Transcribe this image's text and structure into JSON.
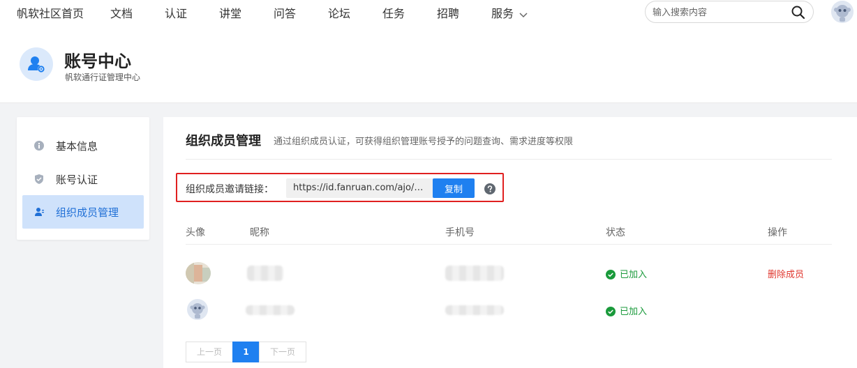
{
  "nav": {
    "items": [
      "帆软社区首页",
      "文档",
      "认证",
      "讲堂",
      "问答",
      "论坛",
      "任务",
      "招聘",
      "服务"
    ],
    "search_placeholder": "输入搜索内容"
  },
  "header": {
    "title": "账号中心",
    "subtitle": "帆软通行证管理中心"
  },
  "sidebar": {
    "items": [
      {
        "label": "基本信息",
        "icon": "info-icon"
      },
      {
        "label": "账号认证",
        "icon": "shield-icon"
      },
      {
        "label": "组织成员管理",
        "icon": "user-icon",
        "active": true
      }
    ]
  },
  "main": {
    "title": "组织成员管理",
    "description": "通过组织成员认证，可获得组织管理账号授予的问题查询、需求进度等权限",
    "invite_label": "组织成员邀请链接：",
    "invite_link": "https://id.fanruan.com/ajo/?ce...",
    "copy_label": "复制",
    "columns": [
      "头像",
      "昵称",
      "手机号",
      "状态",
      "操作"
    ],
    "rows": [
      {
        "status": "已加入",
        "action": "删除成员"
      },
      {
        "status": "已加入",
        "action": ""
      }
    ],
    "pagination": {
      "prev": "上一页",
      "current": "1",
      "next": "下一页"
    }
  },
  "colors": {
    "accent": "#1f80f0",
    "active_bg": "#cfe2fb",
    "success": "#1a9a3b",
    "danger": "#e0382f",
    "highlight_border": "#e02020"
  }
}
